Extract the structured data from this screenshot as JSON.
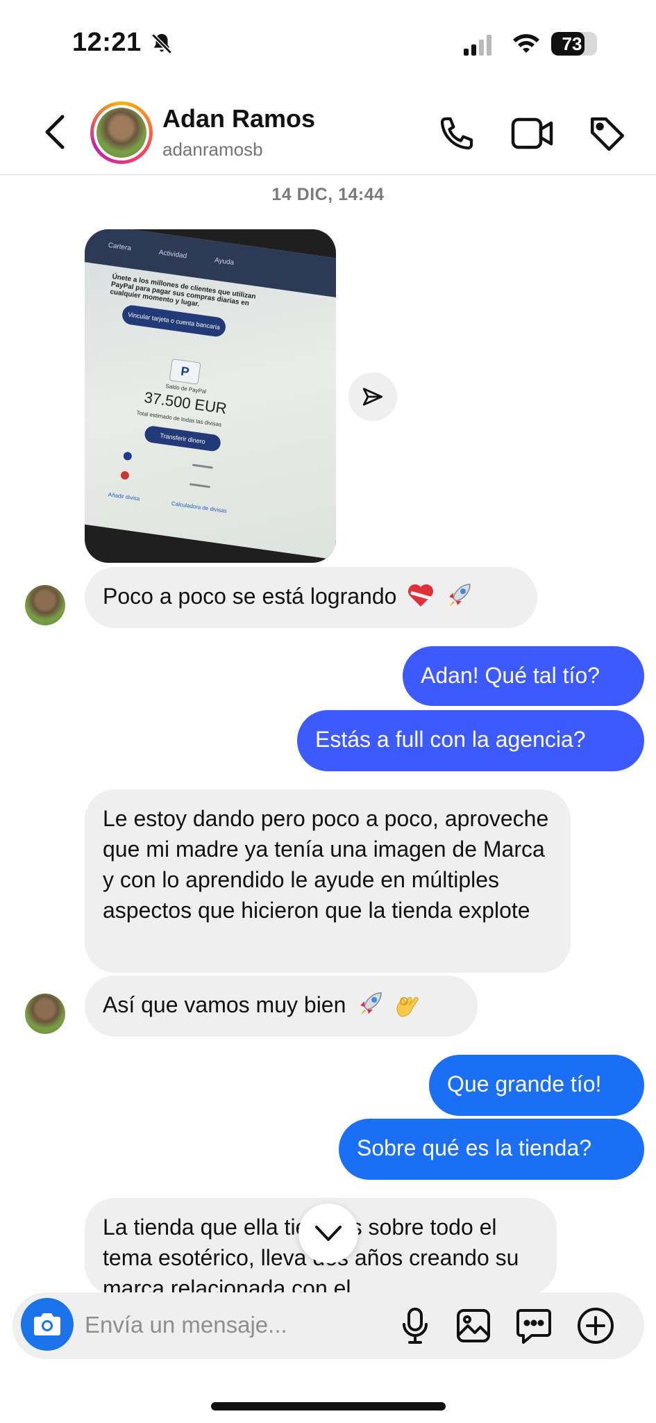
{
  "status_bar": {
    "time": "12:21",
    "battery": "73",
    "battery_level": 0.73
  },
  "header": {
    "name": "Adan Ramos",
    "username": "adanramosb"
  },
  "conversation": {
    "timestamp": "14 DIC, 14:44",
    "photo": {
      "menu_items": [
        "Cartera",
        "Actividad",
        "Ayuda"
      ],
      "promo_text": "Únete a los millones de clientes que utilizan PayPal para pagar sus compras diarias en cualquier momento y lugar.",
      "link_button": "Vincular tarjeta o cuenta bancaria",
      "balance_label": "Saldo de PayPal",
      "balance": "37.500 EUR",
      "balance_note": "Total estimado de todas las divisas",
      "transfer_button": "Transferir dinero",
      "add_currency": "Añadir divisa",
      "currency_calc": "Calculadora de divisas"
    },
    "messages": [
      {
        "from": "them",
        "text": "Poco a poco se está logrando",
        "emojis": [
          "heart",
          "rocket"
        ]
      },
      {
        "from": "me",
        "text": "Adan! Qué tal tío?"
      },
      {
        "from": "me",
        "text": "Estás a full con la agencia?"
      },
      {
        "from": "them",
        "text": "Le estoy dando pero poco a poco, aproveche que mi madre ya tenía una imagen de Marca y con lo aprendido le ayude en múltiples aspectos que hicieron que la tienda explote"
      },
      {
        "from": "them",
        "text": "Así que vamos muy bien",
        "emojis": [
          "rocket",
          "ok-hand"
        ]
      },
      {
        "from": "me",
        "text": "Que grande tío!"
      },
      {
        "from": "me",
        "text": "Sobre qué es la tienda?"
      },
      {
        "from": "them",
        "text": "La tienda que ella tiene es sobre todo el tema esotérico, lleva dos años creando su marca relacionada con el"
      }
    ]
  },
  "composer": {
    "placeholder": "Envía un mensaje..."
  },
  "colors": {
    "outgoing": "#3d5afe",
    "outgoing_alt": "#1a6ff5",
    "incoming": "#efefef",
    "camera": "#1a73e8"
  }
}
